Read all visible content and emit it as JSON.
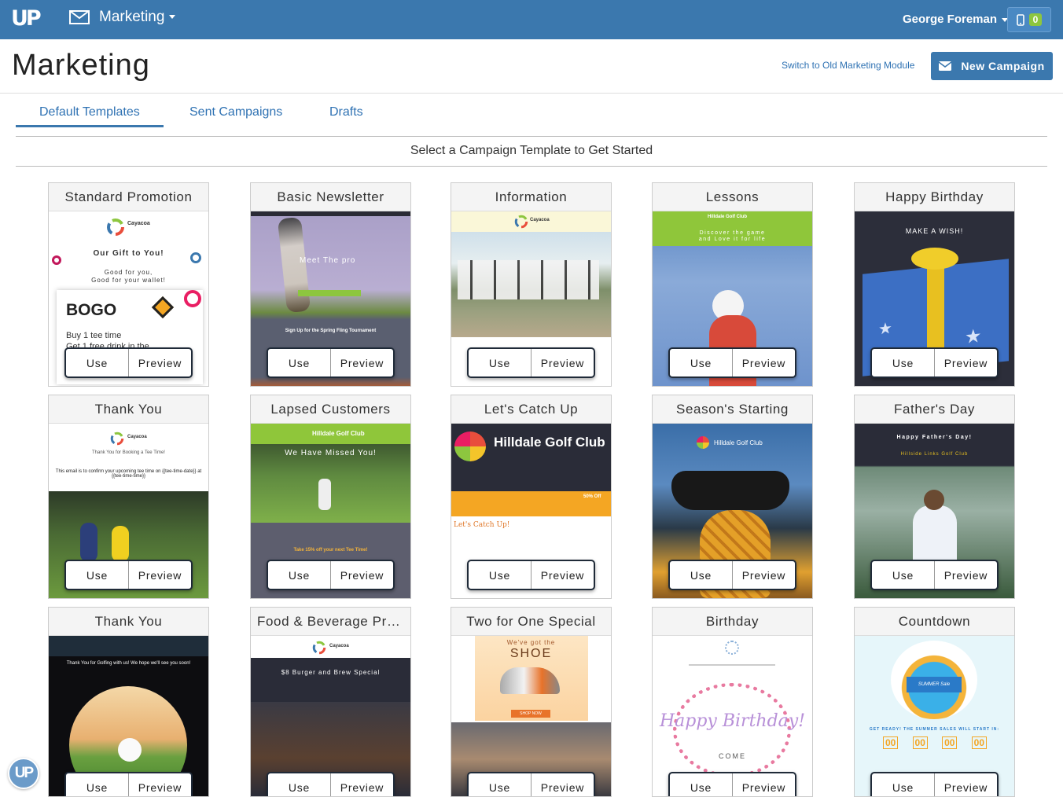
{
  "topbar": {
    "logo": "UP",
    "module_label": "Marketing",
    "user_name": "George Foreman",
    "notification_count": "0"
  },
  "header": {
    "title": "Marketing",
    "switch_link": "Switch to Old Marketing Module",
    "new_campaign": "New Campaign"
  },
  "tabs": [
    "Default Templates",
    "Sent Campaigns",
    "Drafts"
  ],
  "select_prompt": "Select a Campaign Template to Get Started",
  "button_labels": {
    "use": "Use",
    "preview": "Preview"
  },
  "templates": [
    {
      "title": "Standard Promotion",
      "text": [
        "Cayacoa",
        "Our Gift to You!",
        "Good for you,",
        "Good for your wallet!",
        "BOGO",
        "Buy 1 tee time",
        "Get 1 free drink in the"
      ]
    },
    {
      "title": "Basic Newsletter",
      "text": [
        "Meet The pro",
        "Sign Up for the Spring Fling Tournament"
      ]
    },
    {
      "title": "Information",
      "text": [
        "Cayacoa"
      ]
    },
    {
      "title": "Lessons",
      "text": [
        "Hilldale Golf Club",
        "Discover the game",
        "and Love it for life"
      ]
    },
    {
      "title": "Happy Birthday",
      "text": [
        "MAKE A WISH!"
      ]
    },
    {
      "title": "Thank You",
      "text": [
        "Cayacoa",
        "Thank You for Booking a Tee Time!",
        "This email is to confirm your upcoming tee time on {{tee-time-date}} at {{tee-time-time}}"
      ]
    },
    {
      "title": "Lapsed Customers",
      "text": [
        "Hilldale Golf Club",
        "We Have Missed You!",
        "Take 15% off your next Tee Time!"
      ]
    },
    {
      "title": "Let's Catch Up",
      "text": [
        "Hilldale Golf Club",
        "50% Off",
        "Let's Catch Up!"
      ]
    },
    {
      "title": "Season's Starting",
      "text": [
        "Hilldale Golf Club"
      ]
    },
    {
      "title": "Father's Day",
      "text": [
        "Happy Father's Day!",
        "Hillside Links Golf Club"
      ]
    },
    {
      "title": "Thank You",
      "text": [
        "Thank You for Golfing with us! We hope we'll see you soon!"
      ]
    },
    {
      "title": "Food & Beverage Pro...",
      "text": [
        "Cayacoa",
        "$8 Burger and Brew Special"
      ]
    },
    {
      "title": "Two for One Special",
      "text": [
        "We've got the",
        "SHOE",
        "SHOP NOW"
      ]
    },
    {
      "title": "Birthday",
      "text": [
        "Happy Birthday!",
        "COME"
      ]
    },
    {
      "title": "Countdown",
      "text": [
        "SUMMER Sale",
        "GET READY! THE SUMMER SALES WILL START IN:",
        "00",
        "00",
        "00",
        "00"
      ]
    }
  ],
  "colors": {
    "topbar": "#3b78ae",
    "accent": "#3b78ae",
    "link": "#2f72b3",
    "badge": "#8dc63f"
  },
  "icons": [
    "envelope-icon",
    "phone-icon",
    "caret-down-icon",
    "up-logo-icon"
  ]
}
